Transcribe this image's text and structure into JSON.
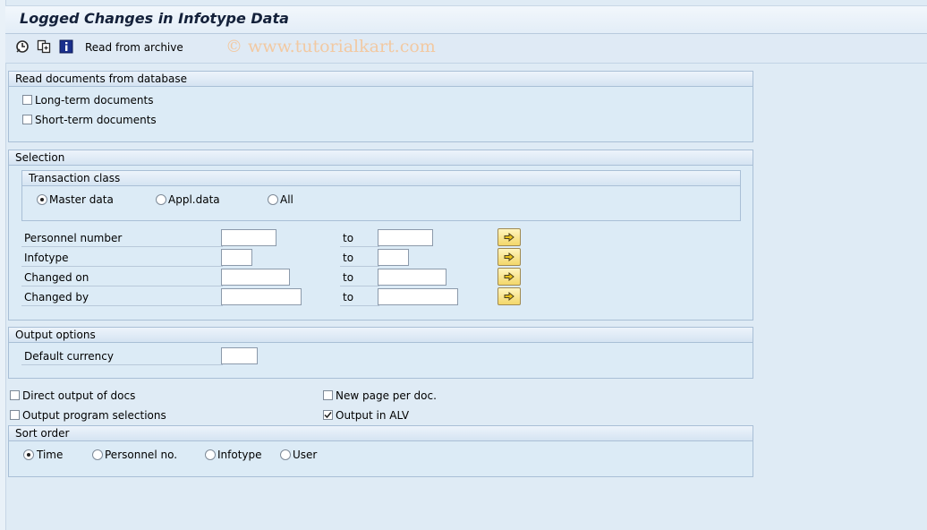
{
  "window": {
    "title": "Logged Changes in Infotype Data"
  },
  "toolbar": {
    "icons": [
      "execute-icon",
      "get-variant-icon",
      "program-documentation-icon"
    ],
    "read_from_archive": "Read from archive"
  },
  "watermark": "© www.tutorialkart.com",
  "read_docs": {
    "title": "Read documents from database",
    "long_term": {
      "label": "Long-term documents",
      "checked": false
    },
    "short_term": {
      "label": "Short-term documents",
      "checked": false
    }
  },
  "selection": {
    "title": "Selection",
    "transaction_class": {
      "title": "Transaction class",
      "options": [
        "Master data",
        "Appl.data",
        "All"
      ],
      "selected": "Master data"
    },
    "to_label": "to",
    "rows": [
      {
        "label": "Personnel number",
        "low": "",
        "high": ""
      },
      {
        "label": "Infotype",
        "low": "",
        "high": ""
      },
      {
        "label": "Changed on",
        "low": "",
        "high": ""
      },
      {
        "label": "Changed by",
        "low": "",
        "high": ""
      }
    ]
  },
  "output_options": {
    "title": "Output options",
    "default_currency_label": "Default currency",
    "default_currency_value": ""
  },
  "flags": {
    "direct_output": {
      "label": "Direct output of docs",
      "checked": false
    },
    "new_page": {
      "label": "New page per doc.",
      "checked": false
    },
    "output_program_selections": {
      "label": "Output program selections",
      "checked": false
    },
    "output_in_alv": {
      "label": "Output in ALV",
      "checked": true
    }
  },
  "sort_order": {
    "title": "Sort order",
    "options": [
      "Time",
      "Personnel no.",
      "Infotype",
      "User"
    ],
    "selected": "Time"
  }
}
